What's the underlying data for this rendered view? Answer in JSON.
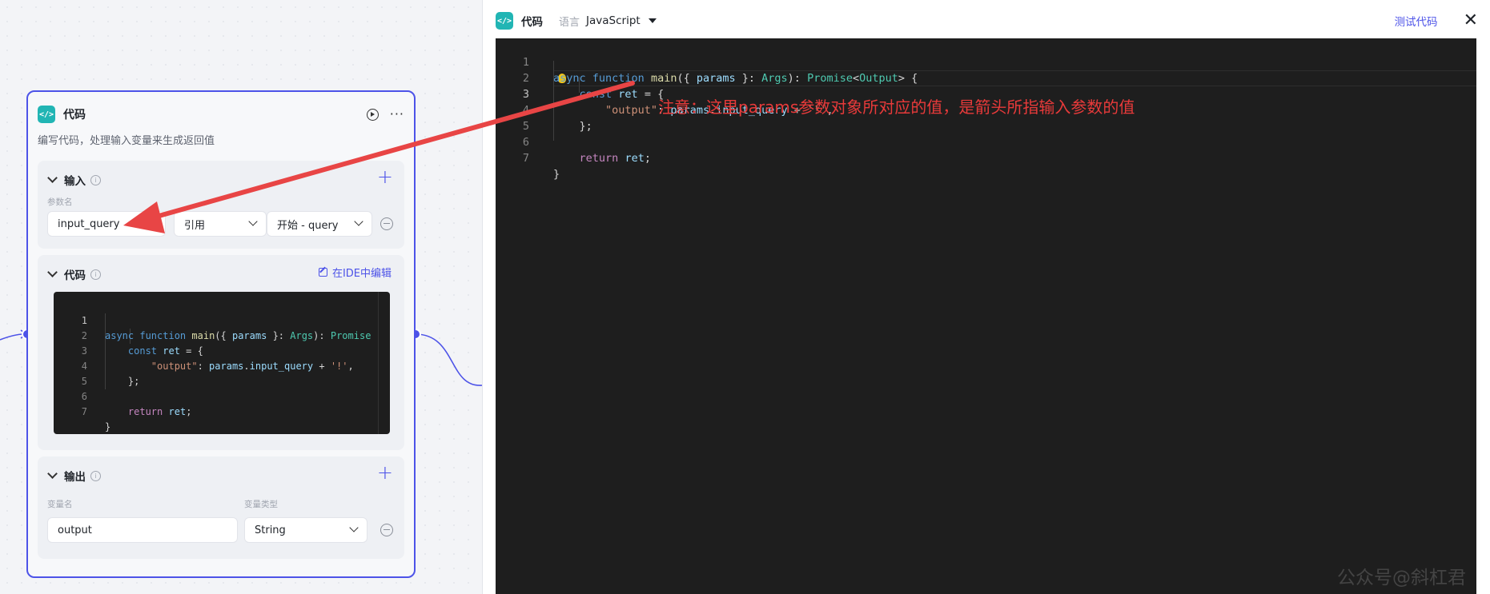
{
  "node": {
    "title": "代码",
    "description": "编写代码，处理输入变量来生成返回值",
    "more": "···",
    "input": {
      "header": "输入",
      "param_label": "参数名",
      "param_value": "input_query",
      "ref_type": "引用",
      "ref_value": "开始 - query"
    },
    "code": {
      "header": "代码",
      "ide_link": "在IDE中编辑",
      "lines": [
        {
          "n": "1"
        },
        {
          "n": "2"
        },
        {
          "n": "3"
        },
        {
          "n": "4"
        },
        {
          "n": "5"
        },
        {
          "n": "6"
        },
        {
          "n": "7"
        }
      ]
    },
    "output": {
      "header": "输出",
      "name_label": "变量名",
      "type_label": "变量类型",
      "name_value": "output",
      "type_value": "String"
    }
  },
  "panel": {
    "title": "代码",
    "lang_label": "语言",
    "lang_value": "JavaScript",
    "test_button": "测试代码",
    "close": "✕",
    "lines": [
      {
        "n": "1"
      },
      {
        "n": "2"
      },
      {
        "n": "3"
      },
      {
        "n": "4"
      },
      {
        "n": "5"
      },
      {
        "n": "6"
      },
      {
        "n": "7"
      }
    ]
  },
  "code_tokens": {
    "async": "async",
    "function": "function",
    "main": "main",
    "params": "params",
    "args": "Args",
    "promise": "Promise",
    "output_type": "Output",
    "const": "const",
    "ret": "ret",
    "output_key": "\"output\"",
    "input_query": "input_query",
    "bang": "'!'",
    "return": "return"
  },
  "annotation": "注意：这里params参数对象所对应的值，是箭头所指输入参数的值",
  "watermark": "公众号@斜杠君",
  "colors": {
    "accent": "#4d53e8",
    "annotation": "#e83a3a",
    "code_logo": "#21b5b4"
  }
}
